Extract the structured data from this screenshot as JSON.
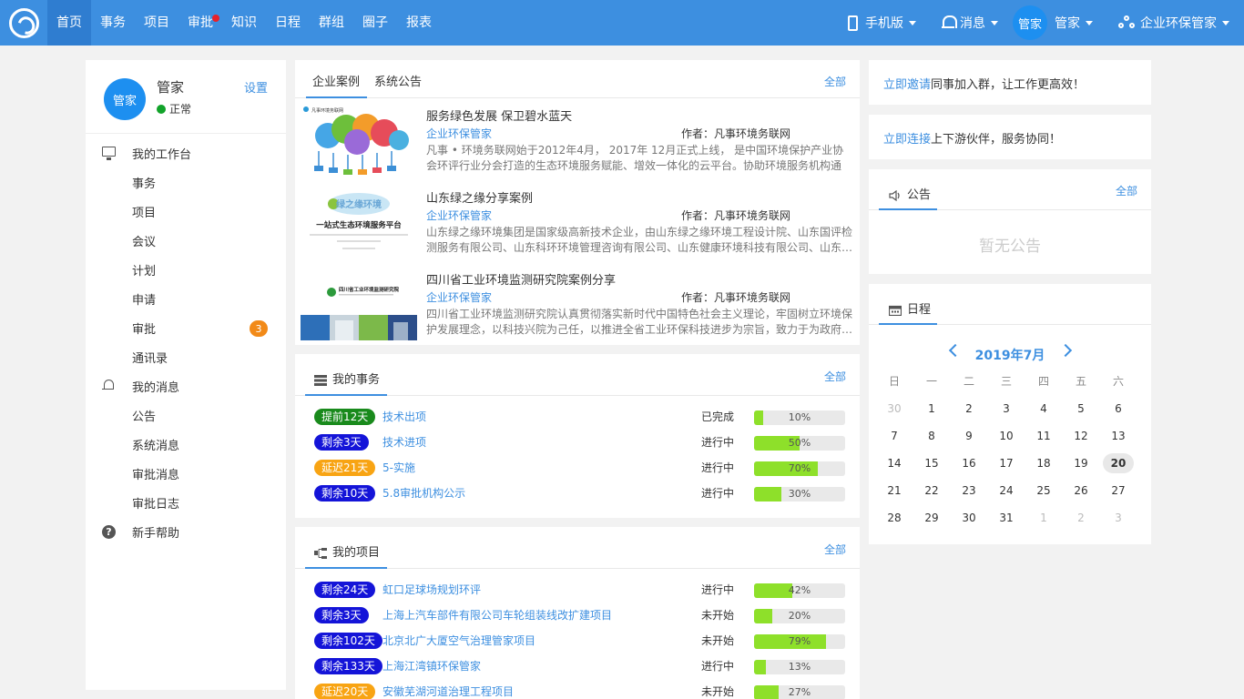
{
  "nav": {
    "items": [
      "首页",
      "事务",
      "项目",
      "审批",
      "知识",
      "日程",
      "群组",
      "圈子",
      "报表"
    ],
    "mobile": "手机版",
    "messages": "消息",
    "user_avatar": "管家",
    "user_name": "管家",
    "org": "企业环保管家"
  },
  "profile": {
    "avatar": "管家",
    "name": "管家",
    "status": "正常",
    "settings": "设置"
  },
  "sidebar": {
    "workbench": "我的工作台",
    "items": [
      "事务",
      "项目",
      "会议",
      "计划",
      "申请",
      "审批",
      "通讯录"
    ],
    "approval_badge": "3",
    "messages": "我的消息",
    "msg_items": [
      "公告",
      "系统消息",
      "审批消息",
      "审批日志"
    ],
    "help": "新手帮助"
  },
  "cases": {
    "tabs": [
      "企业案例",
      "系统公告"
    ],
    "more": "全部",
    "items": [
      {
        "title": "服务绿色发展 保卫碧水蓝天",
        "org": "企业环保管家",
        "author": "作者：凡事环境务联网",
        "desc": "凡事 • 环境务联网始于2012年4月， 2017年 12月正式上线， 是中国环境保护产业协会环评行业分会打造的生态环境服务赋能、增效一体化的云平台。协助环境服务机构通过…"
      },
      {
        "title": "山东绿之缘分享案例",
        "org": "企业环保管家",
        "author": "作者：凡事环境务联网",
        "desc": "山东绿之缘环境集团是国家级高新技术企业，由山东绿之缘环境工程设计院、山东国评检测服务有限公司、山东科环环境管理咨询有限公司、山东健康环境科技有限公司、山东…"
      },
      {
        "title": "四川省工业环境监测研究院案例分享",
        "org": "企业环保管家",
        "author": "作者：凡事环境务联网",
        "desc": "四川省工业环境监测研究院认真贯彻落实新时代中国特色社会主义理论，牢固树立环境保护发展理念，以科技兴院为己任，以推进全省工业环保科技进步为宗旨，致力于为政府…"
      }
    ],
    "img_text": {
      "logo1": "凡事环境务联网",
      "banner2_title": "绿之缘环境",
      "banner2_sub": "一站式生态环境服务平台",
      "banner3_title": "四川省工业环境监测研究院"
    }
  },
  "tasks": {
    "title": "我的事务",
    "more": "全部",
    "rows": [
      {
        "pill": "提前12天",
        "color": "green",
        "name": "技术出项",
        "state": "已完成",
        "pct": 10,
        "pct_label": "10%"
      },
      {
        "pill": "剩余3天",
        "color": "blue",
        "name": "技术进项",
        "state": "进行中",
        "pct": 50,
        "pct_label": "50%"
      },
      {
        "pill": "延迟21天",
        "color": "orange",
        "name": "5-实施",
        "state": "进行中",
        "pct": 70,
        "pct_label": "70%"
      },
      {
        "pill": "剩余10天",
        "color": "blue",
        "name": "5.8审批机构公示",
        "state": "进行中",
        "pct": 30,
        "pct_label": "30%"
      }
    ]
  },
  "projects": {
    "title": "我的项目",
    "more": "全部",
    "rows": [
      {
        "pill": "剩余24天",
        "color": "blue",
        "name": "虹口足球场规划环评",
        "state": "进行中",
        "pct": 42,
        "pct_label": "42%"
      },
      {
        "pill": "剩余3天",
        "color": "blue",
        "name": "上海上汽车部件有限公司车轮组装线改扩建项目",
        "state": "未开始",
        "pct": 20,
        "pct_label": "20%"
      },
      {
        "pill": "剩余102天",
        "color": "blue",
        "name": "北京北广大厦空气治理管家项目",
        "state": "未开始",
        "pct": 79,
        "pct_label": "79%"
      },
      {
        "pill": "剩余133天",
        "color": "blue",
        "name": "上海江湾镇环保管家",
        "state": "进行中",
        "pct": 13,
        "pct_label": "13%"
      },
      {
        "pill": "延迟20天",
        "color": "orange",
        "name": "安徽芜湖河道治理工程项目",
        "state": "未开始",
        "pct": 27,
        "pct_label": "27%"
      }
    ]
  },
  "invite": {
    "link": "立即邀请",
    "text": "同事加入群，让工作更高效！"
  },
  "connect": {
    "link": "立即连接",
    "text": "上下游伙伴，服务协同！"
  },
  "notice": {
    "title": "公告",
    "more": "全部",
    "empty": "暂无公告"
  },
  "calendar": {
    "title": "日程",
    "month": "2019年7月",
    "weekdays": [
      "日",
      "一",
      "二",
      "三",
      "四",
      "五",
      "六"
    ],
    "today": 20,
    "days": [
      [
        30,
        true
      ],
      [
        1,
        false
      ],
      [
        2,
        false
      ],
      [
        3,
        false
      ],
      [
        4,
        false
      ],
      [
        5,
        false
      ],
      [
        6,
        false
      ],
      [
        7,
        false
      ],
      [
        8,
        false
      ],
      [
        9,
        false
      ],
      [
        10,
        false
      ],
      [
        11,
        false
      ],
      [
        12,
        false
      ],
      [
        13,
        false
      ],
      [
        14,
        false
      ],
      [
        15,
        false
      ],
      [
        16,
        false
      ],
      [
        17,
        false
      ],
      [
        18,
        false
      ],
      [
        19,
        false
      ],
      [
        20,
        false
      ],
      [
        21,
        false
      ],
      [
        22,
        false
      ],
      [
        23,
        false
      ],
      [
        24,
        false
      ],
      [
        25,
        false
      ],
      [
        26,
        false
      ],
      [
        27,
        false
      ],
      [
        28,
        false
      ],
      [
        29,
        false
      ],
      [
        30,
        false
      ],
      [
        31,
        false
      ],
      [
        1,
        true
      ],
      [
        2,
        true
      ],
      [
        3,
        true
      ]
    ]
  },
  "colors": {
    "brand": "#3d8fe0",
    "badge": "#f28a18",
    "green_pill": "#198a1c",
    "blue_pill": "#1414d8",
    "orange_pill": "#f8a413",
    "progress": "#8ee02a"
  }
}
